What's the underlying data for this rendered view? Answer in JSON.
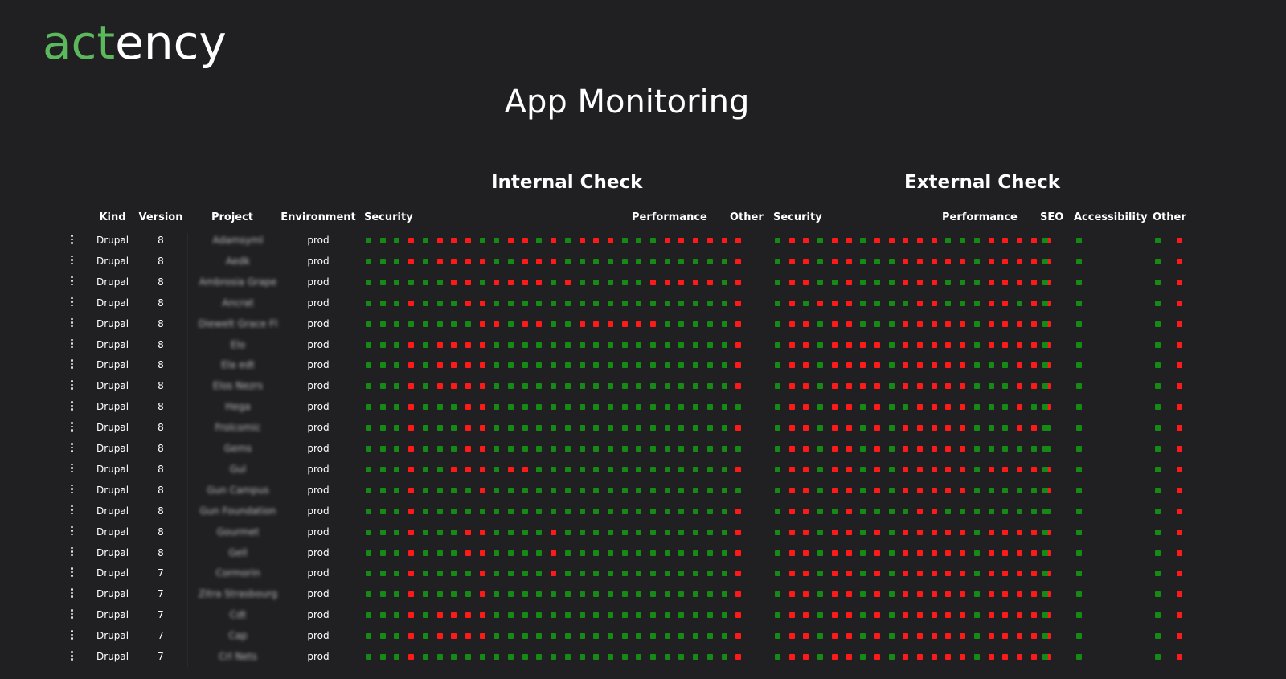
{
  "brand": {
    "logo_green": "act",
    "logo_white": "ency",
    "green_color": "#5cb85c"
  },
  "page_title": "App Monitoring",
  "sections": {
    "internal": "Internal Check",
    "external": "External Check"
  },
  "columns": {
    "kind": "Kind",
    "version": "Version",
    "project": "Project",
    "environment": "Environment"
  },
  "internal_groups": {
    "security": "Security",
    "performance": "Performance",
    "other": "Other"
  },
  "external_groups": {
    "security": "Security",
    "performance": "Performance",
    "seo": "SEO",
    "accessibility": "Accessibility",
    "other": "Other"
  },
  "status_colors": {
    "ok": "#158b15",
    "fail": "#ff1a1a"
  },
  "rows": [
    {
      "kind": "Drupal",
      "version": "8",
      "project": "Adamsyml",
      "env": "prod",
      "internal": "0001011100110101110001111110",
      "external": "01101101111100011111111100000000000101"
    },
    {
      "kind": "Drupal",
      "version": "8",
      "project": "Aedk",
      "env": "prod",
      "internal": "0001011110011100000000000010",
      "external": "01101100011111011111111100000000000101"
    },
    {
      "kind": "Drupal",
      "version": "8",
      "project": "Ambrosia Grape",
      "env": "prod",
      "internal": "0000001101111010000011111010",
      "external": "01100100011100011111011100000000000101"
    },
    {
      "kind": "Drupal",
      "version": "8",
      "project": "Ancrat",
      "env": "prod",
      "internal": "0001000110000000000000000010",
      "external": "01011100001100011011111100000000000101"
    },
    {
      "kind": "Drupal",
      "version": "8",
      "project": "Diewelt Grace Fl",
      "env": "prod",
      "internal": "0000000011011001111110000010",
      "external": "01101100011111011111110100000000000101"
    },
    {
      "kind": "Drupal",
      "version": "8",
      "project": "Elo",
      "env": "prod",
      "internal": "0001011110000000000000000010",
      "external": "01101111011111011111111100000000000101"
    },
    {
      "kind": "Drupal",
      "version": "8",
      "project": "Ela edt",
      "env": "prod",
      "internal": "0001011110000000000000000010",
      "external": "01101111011111000111111100000000000101"
    },
    {
      "kind": "Drupal",
      "version": "8",
      "project": "Elos Nezrs",
      "env": "prod",
      "internal": "0001011110000000000000000010",
      "external": "01101111011111000111111100000000000101"
    },
    {
      "kind": "Drupal",
      "version": "8",
      "project": "Hega",
      "env": "prod",
      "internal": "0001000110000000000000000000",
      "external": "01101101001111000101111100000000000101"
    },
    {
      "kind": "Drupal",
      "version": "8",
      "project": "Frolcomic",
      "env": "prod",
      "internal": "0001000110000000000000000010",
      "external": "01101101011111000110011100000000000101"
    },
    {
      "kind": "Drupal",
      "version": "8",
      "project": "Gems",
      "env": "prod",
      "internal": "0001000110000000000000000000",
      "external": "01101101011111000000011100000000000101"
    },
    {
      "kind": "Drupal",
      "version": "8",
      "project": "Gul",
      "env": "prod",
      "internal": "0001001110110000000000000010",
      "external": "01101101011111011111111100000000000101"
    },
    {
      "kind": "Drupal",
      "version": "8",
      "project": "Gun Campus",
      "env": "prod",
      "internal": "0001000010000000000000000000",
      "external": "01101101011111000001111100000000000101"
    },
    {
      "kind": "Drupal",
      "version": "8",
      "project": "Gun Foundation",
      "env": "prod",
      "internal": "0001000000000000000000000010",
      "external": "01100100001100000000100000000000000101"
    },
    {
      "kind": "Drupal",
      "version": "8",
      "project": "Gourmet",
      "env": "prod",
      "internal": "0001000110000100000000000010",
      "external": "01101101011111011111111100000000000101"
    },
    {
      "kind": "Drupal",
      "version": "8",
      "project": "Gell",
      "env": "prod",
      "internal": "0001000110000100000000000010",
      "external": "01101101011111011111111100000000000101"
    },
    {
      "kind": "Drupal",
      "version": "7",
      "project": "Cormorin",
      "env": "prod",
      "internal": "0001000010000100000000000010",
      "external": "01101101011111011111111100000000000101"
    },
    {
      "kind": "Drupal",
      "version": "7",
      "project": "Zitra Strasbourg",
      "env": "prod",
      "internal": "0001000010000000000000000010",
      "external": "01101101011111011111111100000000000101"
    },
    {
      "kind": "Drupal",
      "version": "7",
      "project": "Cdt",
      "env": "prod",
      "internal": "0001011110000000000000000010",
      "external": "01101101011111011111111100000000000101"
    },
    {
      "kind": "Drupal",
      "version": "7",
      "project": "Cap",
      "env": "prod",
      "internal": "0001011110000000000000000010",
      "external": "01101101011111011111111100000000000101"
    },
    {
      "kind": "Drupal",
      "version": "7",
      "project": "Crl Nets",
      "env": "prod",
      "internal": "0001000000000000000000000010",
      "external": "01101101011111011111111100000000000101"
    }
  ]
}
